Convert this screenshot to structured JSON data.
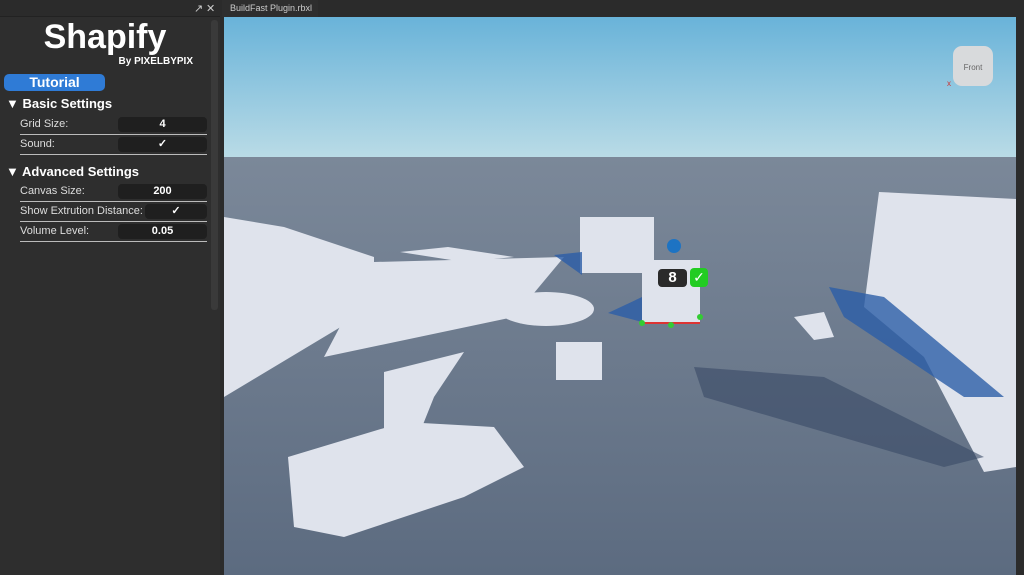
{
  "panel": {
    "title": "Shapify",
    "byline": "By PIXELBYPIX",
    "tutorial": "Tutorial",
    "basic": {
      "header": "▼ Basic Settings",
      "rows": [
        {
          "label": "Grid Size:",
          "value": "4"
        },
        {
          "label": "Sound:",
          "value": "✓"
        }
      ]
    },
    "advanced": {
      "header": "▼ Advanced Settings",
      "rows": [
        {
          "label": "Canvas Size:",
          "value": "200"
        },
        {
          "label": "Show Extrution Distance:",
          "value": "✓"
        },
        {
          "label": "Volume Level:",
          "value": "0.05"
        }
      ]
    },
    "popout_icon": "↗",
    "close_icon": "✕"
  },
  "tab": {
    "label": "BuildFast Plugin.rbxl",
    "close": "✕"
  },
  "viewport": {
    "count_badge": "8",
    "confirm": "✓",
    "view_cube": "Front",
    "axis_x": "x"
  }
}
